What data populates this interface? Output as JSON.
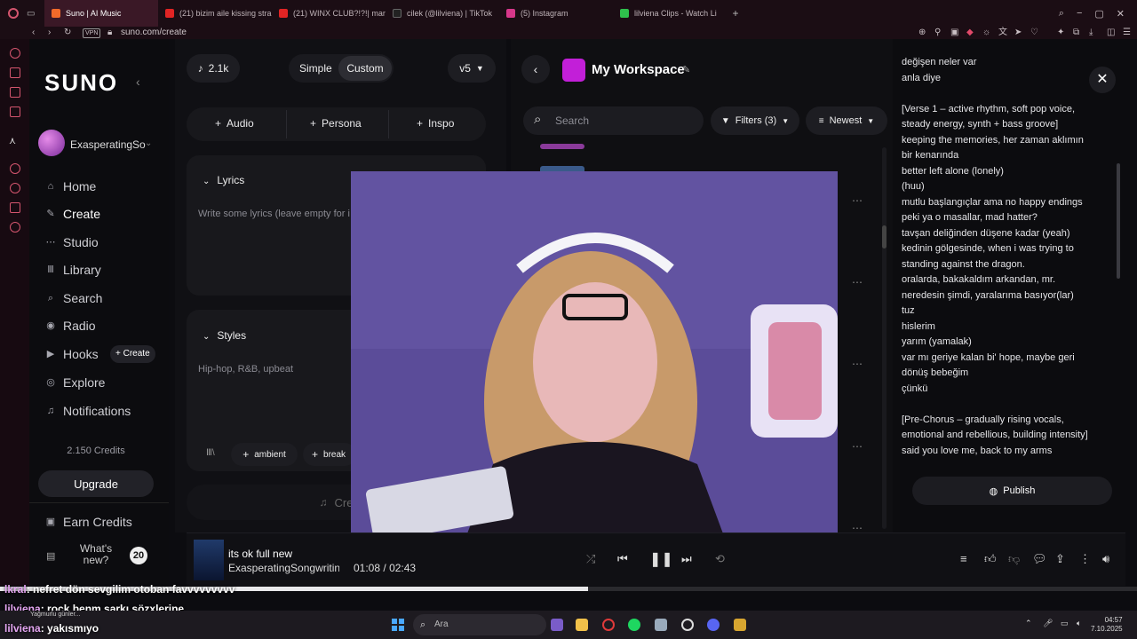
{
  "browser": {
    "tabs": [
      {
        "label": "Suno | AI Music",
        "active": true,
        "color": "#f26a2a"
      },
      {
        "label": "(21) bizim aile kissing stra",
        "active": false,
        "color": "#e02424"
      },
      {
        "label": "(21) WINX CLUB?!?!| mar",
        "active": false,
        "color": "#e02424"
      },
      {
        "label": "cilek (@lilviena) | TikTok",
        "active": false,
        "color": "#222222"
      },
      {
        "label": "(5) Instagram",
        "active": false,
        "color": "#d6378a"
      },
      {
        "label": "lilviena Clips - Watch Li",
        "active": false,
        "color": "#2fbf4c"
      }
    ],
    "url": "suno.com/create",
    "vpn": "VPN"
  },
  "nav": {
    "logo": "SUNO",
    "username": "ExasperatingSo",
    "items": [
      {
        "label": "Home",
        "icon": "home-icon",
        "glyph": "⌂"
      },
      {
        "label": "Create",
        "icon": "create-icon",
        "glyph": "✎"
      },
      {
        "label": "Studio",
        "icon": "studio-icon",
        "glyph": "⋯"
      },
      {
        "label": "Library",
        "icon": "library-icon",
        "glyph": "Ⅲ"
      },
      {
        "label": "Search",
        "icon": "search-icon",
        "glyph": "⌕"
      },
      {
        "label": "Radio",
        "icon": "radio-icon",
        "glyph": "◉"
      },
      {
        "label": "Hooks",
        "icon": "hooks-icon",
        "glyph": "▶"
      },
      {
        "label": "Explore",
        "icon": "explore-icon",
        "glyph": "◎"
      },
      {
        "label": "Notifications",
        "icon": "bell-icon",
        "glyph": "♫"
      }
    ],
    "hooks_create": "+ Create",
    "credits": "2.150 Credits",
    "upgrade": "Upgrade",
    "earn_credits": "Earn Credits",
    "whats_new": "What's new?",
    "whats_new_count": "20"
  },
  "create": {
    "song_count": "2.1k",
    "mode_simple": "Simple",
    "mode_custom": "Custom",
    "version": "v5",
    "audio": "Audio",
    "persona": "Persona",
    "inspo": "Inspo",
    "lyrics_title": "Lyrics",
    "lyrics_placeholder": "Write some lyrics (leave empty for i",
    "styles_title": "Styles",
    "styles_value": "Hip-hop, R&B, upbeat",
    "tags": [
      "ambient",
      "break"
    ],
    "create_button": "Cre"
  },
  "workspace": {
    "title": "My Workspace",
    "search_placeholder": "Search",
    "filters": "Filters (3)",
    "sort": "Newest"
  },
  "lyrics_panel": {
    "lines": [
      "değişen neler var",
      "anla diye",
      "",
      "[Verse 1 – active rhythm, soft pop voice,",
      "steady energy, synth + bass groove]",
      "keeping the memories, her zaman aklımın",
      "bir kenarında",
      "better left alone (lonely)",
      "(huu)",
      "mutlu başlangıçlar ama no happy endings",
      "peki ya o masallar, mad hatter?",
      "tavşan deliğinden düşene kadar (yeah)",
      "kedinin gölgesinde, when i was trying to",
      "standing against the dragon.",
      "oralarda, bakakaldım arkandan, mr.",
      "neredesin şimdi, yaralarıma basıyor(lar)",
      "tuz",
      "hislerim",
      "yarım (yamalak)",
      "var mı geriye kalan bi' hope, maybe geri",
      "dönüş bebeğim",
      "çünkü",
      "",
      "[Pre-Chorus – gradually rising vocals,",
      "emotional and rebellious, building intensity]",
      "said you love me, back to my arms"
    ],
    "publish": "Publish"
  },
  "player": {
    "title": "its ok full new",
    "artist": "ExasperatingSongwriting",
    "current_time": "01:08",
    "separator": "/",
    "duration": "02:43",
    "progress": 0.417
  },
  "chat": [
    {
      "user": "lkral",
      "message": ": nefret dön sevgilim otoban favvvvvvvvv"
    },
    {
      "user": "lilviena",
      "message": ": rock benm şarkı sözxlerine"
    },
    {
      "user": "lilviena",
      "message": ": yakısmıyo"
    }
  ],
  "taskbar": {
    "weather": "Yağmurlu günler...",
    "search": "Ara",
    "time": "04:57",
    "date": "7.10.2025"
  },
  "colors": {
    "accent": "#c21fd8",
    "chrome": "#1b0d14",
    "opera_red": "#d4556e"
  }
}
